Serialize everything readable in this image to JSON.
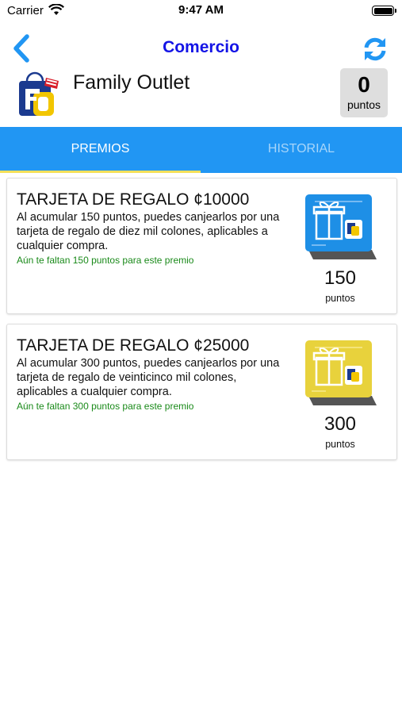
{
  "status_bar": {
    "carrier": "Carrier",
    "time": "9:47 AM"
  },
  "nav": {
    "title": "Comercio",
    "back_icon": "chevron-left-icon",
    "refresh_icon": "refresh-icon"
  },
  "merchant": {
    "name": "Family Outlet",
    "points_value": "0",
    "points_label": "puntos"
  },
  "tabs": [
    {
      "label": "PREMIOS",
      "selected": true
    },
    {
      "label": "HISTORIAL",
      "selected": false
    }
  ],
  "rewards": [
    {
      "title": "TARJETA DE REGALO ¢10000",
      "description": "Al acumular 150 puntos, puedes canjearlos por una tarjeta de regalo de diez mil colones, aplicables a cualquier compra.",
      "note": "Aún te faltan 150 puntos para este premio",
      "points": "150",
      "points_label": "puntos",
      "card_color": "#1e8fe6"
    },
    {
      "title": "TARJETA DE REGALO ¢25000",
      "description": "Al acumular 300 puntos, puedes canjearlos por una tarjeta de regalo de veinticinco mil colones, aplicables a cualquier compra.",
      "note": "Aún te faltan 300 puntos para este premio",
      "points": "300",
      "points_label": "puntos",
      "card_color": "#e8d23c"
    }
  ],
  "colors": {
    "accent": "#1414e6",
    "tab_bar": "#2196f3",
    "tab_indicator": "#f4e05a",
    "note_green": "#1a8a1a"
  }
}
